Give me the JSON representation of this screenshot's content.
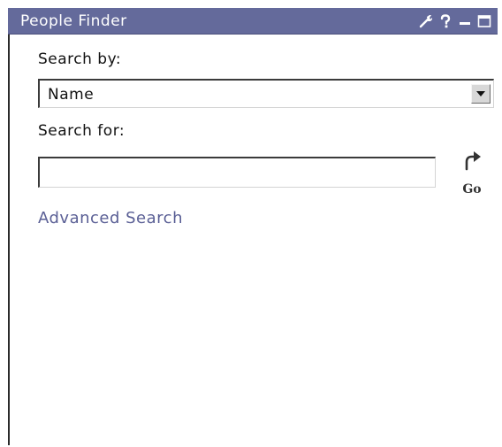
{
  "window": {
    "title": "People Finder",
    "title_bar_color": "#646a9b",
    "controls": [
      "wrench-icon",
      "help-icon",
      "minimize-icon",
      "maximize-icon"
    ]
  },
  "form": {
    "search_by_label": "Search by:",
    "search_by_value": "Name",
    "search_for_label": "Search for:",
    "search_for_value": "",
    "go_label": "Go",
    "advanced_link": "Advanced Search",
    "link_color": "#5a5f95"
  }
}
